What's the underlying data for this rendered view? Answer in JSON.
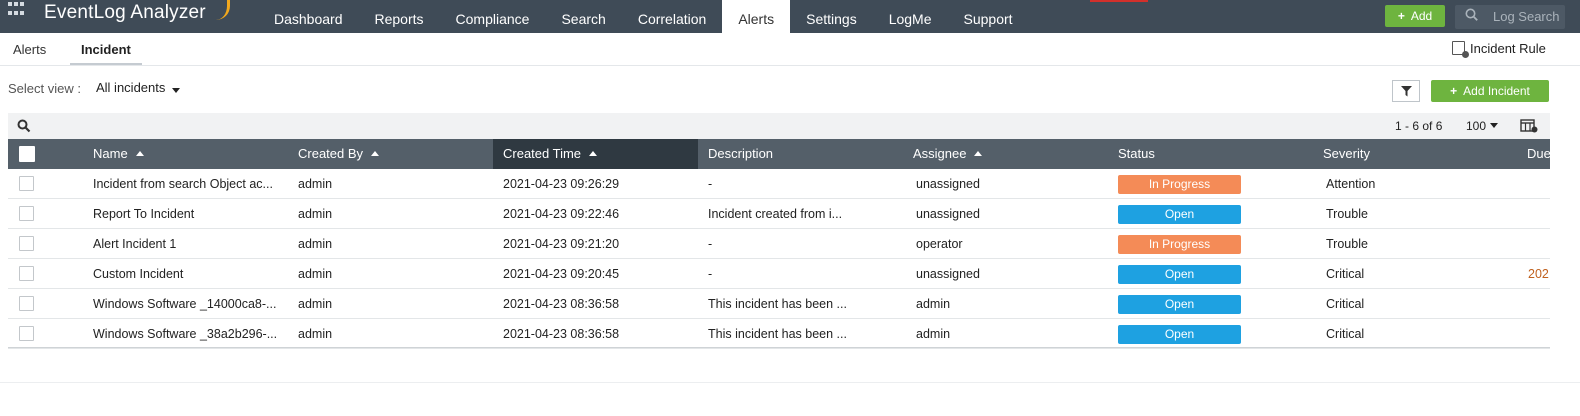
{
  "app": {
    "brand": "EventLog Analyzer",
    "top_tabs": [
      "Dashboard",
      "Reports",
      "Compliance",
      "Search",
      "Correlation",
      "Alerts",
      "Settings",
      "LogMe",
      "Support"
    ],
    "active_tab": "Alerts",
    "add_label": "Add",
    "log_search_placeholder": "Log Search"
  },
  "subnav": {
    "tabs": [
      "Alerts",
      "Incident"
    ],
    "active": "Incident",
    "incident_rule_label": "Incident Rule"
  },
  "view": {
    "select_label": "Select view :",
    "selected": "All incidents",
    "add_incident_label": "Add Incident"
  },
  "table": {
    "pager": "1 - 6 of 6",
    "per_page": "100",
    "columns": [
      "Name",
      "Created By",
      "Created Time",
      "Description",
      "Assignee",
      "Status",
      "Severity",
      "Due"
    ],
    "rows": [
      {
        "name": "Incident from search Object ac...",
        "created_by": "admin",
        "created_time": "2021-04-23 09:26:29",
        "description": "-",
        "assignee": "unassigned",
        "status": "In Progress",
        "severity": "Attention",
        "due": ""
      },
      {
        "name": "Report To Incident",
        "created_by": "admin",
        "created_time": "2021-04-23 09:22:46",
        "description": "Incident created from i...",
        "assignee": "unassigned",
        "status": "Open",
        "severity": "Trouble",
        "due": ""
      },
      {
        "name": "Alert Incident 1",
        "created_by": "admin",
        "created_time": "2021-04-23 09:21:20",
        "description": "-",
        "assignee": "operator",
        "status": "In Progress",
        "severity": "Trouble",
        "due": ""
      },
      {
        "name": "Custom Incident",
        "created_by": "admin",
        "created_time": "2021-04-23 09:20:45",
        "description": "-",
        "assignee": "unassigned",
        "status": "Open",
        "severity": "Critical",
        "due": "202"
      },
      {
        "name": "Windows Software _14000ca8-...",
        "created_by": "admin",
        "created_time": "2021-04-23 08:36:58",
        "description": "This incident has been ...",
        "assignee": "admin",
        "status": "Open",
        "severity": "Critical",
        "due": ""
      },
      {
        "name": "Windows Software _38a2b296-...",
        "created_by": "admin",
        "created_time": "2021-04-23 08:36:58",
        "description": "This incident has been ...",
        "assignee": "admin",
        "status": "Open",
        "severity": "Critical",
        "due": ""
      }
    ]
  },
  "colors": {
    "topbar": "#3f4b57",
    "green_button": "#6eb43f",
    "status_in_progress": "#f48b57",
    "status_open": "#1ea1e1",
    "table_header": "#545f69"
  }
}
